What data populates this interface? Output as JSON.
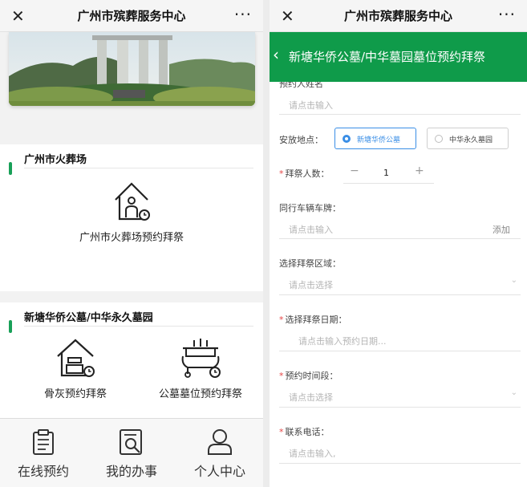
{
  "left": {
    "topbar": {
      "close_icon": "✕",
      "title": "广州市殡葬服务中心",
      "more_icon": "···"
    },
    "banner": {
      "icon": "cemetery-gate-photo"
    },
    "section1": {
      "heading": "广州市火葬场",
      "tiles": [
        {
          "label": "广州市火葬场预约拜祭",
          "icon": "house-clock-icon"
        }
      ]
    },
    "section2": {
      "heading": "新塘华侨公墓/中华永久墓园",
      "tiles": [
        {
          "label": "骨灰预约拜祭",
          "icon": "urn-house-clock-icon"
        },
        {
          "label": "公墓墓位预约拜祭",
          "icon": "altar-clock-icon"
        }
      ]
    },
    "tabbar": [
      {
        "label": "在线预约",
        "icon": "clipboard-icon"
      },
      {
        "label": "我的办事",
        "icon": "document-search-icon"
      },
      {
        "label": "个人中心",
        "icon": "person-icon"
      }
    ]
  },
  "right": {
    "topbar": {
      "close_icon": "✕",
      "title": "广州市殡葬服务中心",
      "more_icon": "···"
    },
    "header": {
      "back_icon": "‹",
      "title": "新塘华侨公墓/中华墓园墓位预约拜祭"
    },
    "form": {
      "cut_label": "预约人姓名",
      "name_placeholder": "请点击输入",
      "location": {
        "label": "安放地点：",
        "options": [
          "新塘华侨公墓",
          "中华永久墓园"
        ],
        "selected": "新塘华侨公墓"
      },
      "count": {
        "required": "*",
        "label": "拜祭人数：",
        "minus": "−",
        "value": "1",
        "plus": "+"
      },
      "plate": {
        "label": "同行车辆车牌：",
        "placeholder": "请点击输入",
        "add": "添加"
      },
      "area": {
        "label": "选择拜祭区域：",
        "placeholder": "请点击选择",
        "chevron": "⌄"
      },
      "date": {
        "required": "*",
        "label": "选择拜祭日期：",
        "placeholder": "请点击输入预约日期..."
      },
      "time": {
        "required": "*",
        "label": "预约时间段：",
        "placeholder": "请点击选择",
        "chevron": "⌄"
      },
      "phone": {
        "required": "*",
        "label": "联系电话：",
        "placeholder": "请点击输入,"
      }
    },
    "accent": "#0f9b4a",
    "radio_accent": "#3a8ee6"
  }
}
